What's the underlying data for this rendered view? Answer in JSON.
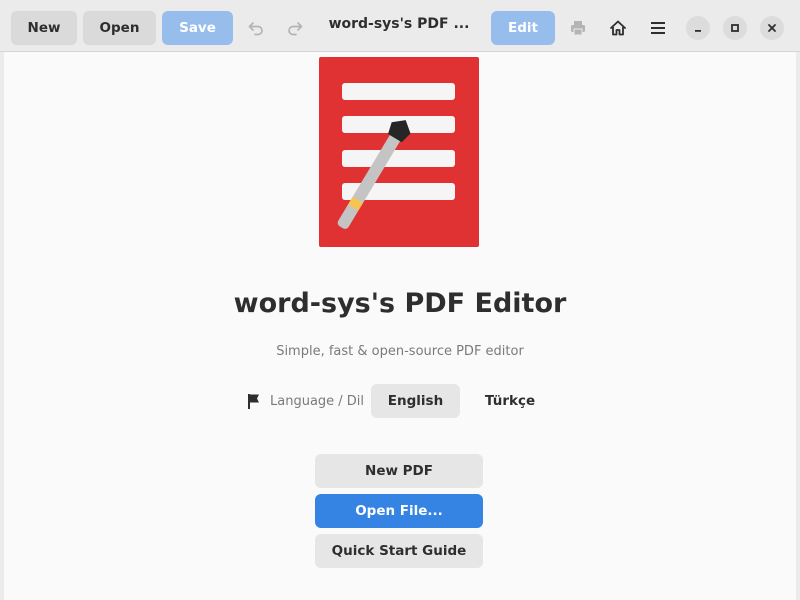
{
  "headerbar": {
    "new_label": "New",
    "open_label": "Open",
    "save_label": "Save",
    "title": "word-sys's PDF ...",
    "edit_label": "Edit"
  },
  "welcome": {
    "app_title": "word-sys's PDF Editor",
    "subtitle": "Simple, fast & open-source PDF editor",
    "language_label": "Language / Dil",
    "languages": [
      {
        "label": "English",
        "selected": true
      },
      {
        "label": "Türkçe",
        "selected": false
      }
    ],
    "actions": {
      "new_pdf": "New PDF",
      "open_file": "Open File...",
      "quick_start": "Quick Start Guide"
    }
  },
  "colors": {
    "accent": "#3584e4",
    "accent_disabled": "#97bdec",
    "logo_red": "#e03232",
    "background": "#fafafa"
  },
  "icons": {
    "undo": "undo-icon",
    "redo": "redo-icon",
    "print": "print-icon",
    "home": "home-icon",
    "menu": "hamburger-menu-icon",
    "minimize": "minimize-icon",
    "maximize": "maximize-icon",
    "close": "close-icon",
    "language": "flag-icon"
  }
}
